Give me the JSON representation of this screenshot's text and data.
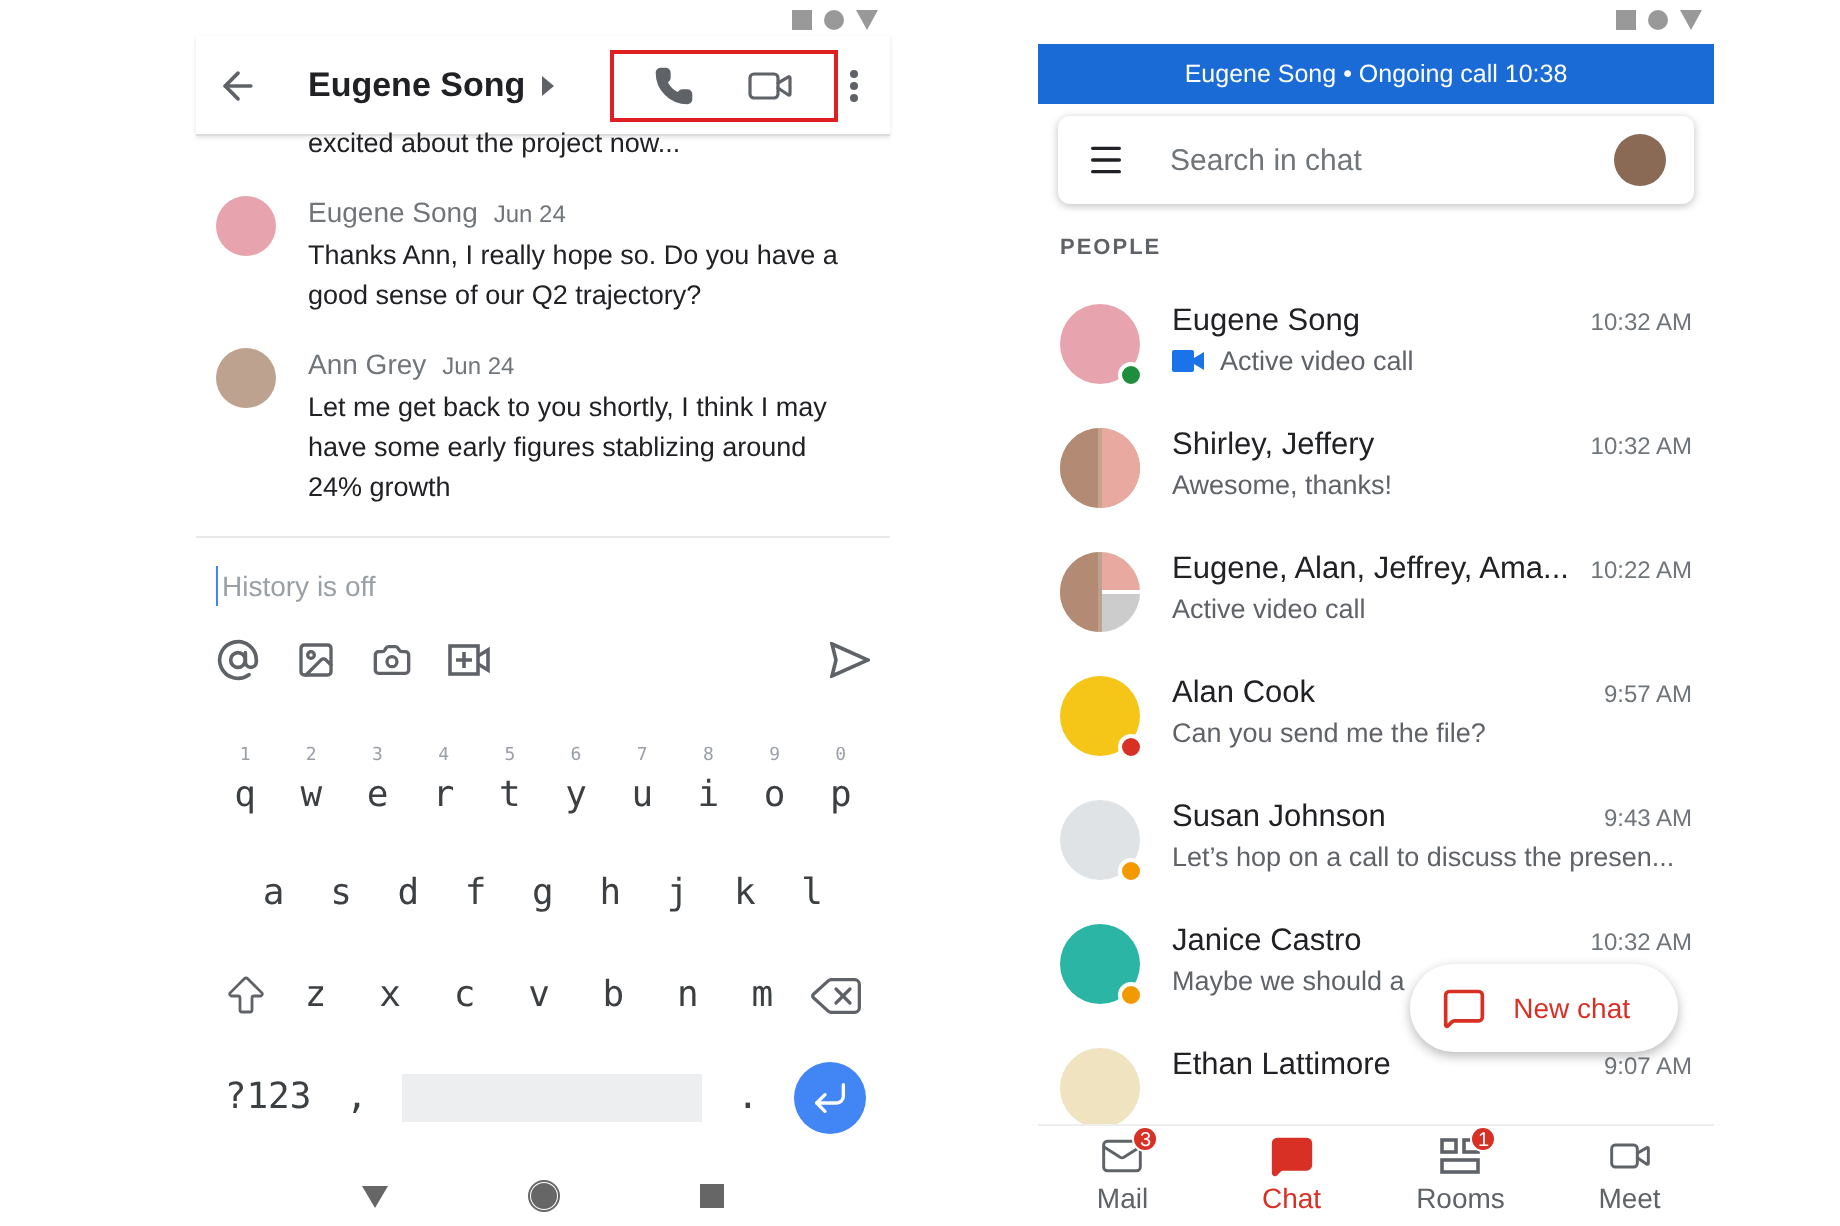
{
  "left_phone": {
    "header": {
      "title": "Eugene Song",
      "call_actions_highlighted": true
    },
    "messages": [
      {
        "kind": "continued",
        "text": "excited about the project now..."
      },
      {
        "kind": "full",
        "sender": "Eugene Song",
        "date": "Jun 24",
        "text": "Thanks Ann, I really hope so. Do you have a good sense of our Q2 trajectory?"
      },
      {
        "kind": "full",
        "sender": "Ann Grey",
        "date": "Jun 24",
        "text": "Let me get back to you shortly, I think I may have some early figures stablizing around 24% growth"
      }
    ],
    "composer": {
      "placeholder": "History is off"
    },
    "keyboard": {
      "rows": [
        [
          {
            "kind": "char",
            "label": "q",
            "hint": "1"
          },
          {
            "kind": "char",
            "label": "w",
            "hint": "2"
          },
          {
            "kind": "char",
            "label": "e",
            "hint": "3"
          },
          {
            "kind": "char",
            "label": "r",
            "hint": "4"
          },
          {
            "kind": "char",
            "label": "t",
            "hint": "5"
          },
          {
            "kind": "char",
            "label": "y",
            "hint": "6"
          },
          {
            "kind": "char",
            "label": "u",
            "hint": "7"
          },
          {
            "kind": "char",
            "label": "i",
            "hint": "8"
          },
          {
            "kind": "char",
            "label": "o",
            "hint": "9"
          },
          {
            "kind": "char",
            "label": "p",
            "hint": "0"
          }
        ],
        [
          {
            "kind": "char",
            "label": "a"
          },
          {
            "kind": "char",
            "label": "s"
          },
          {
            "kind": "char",
            "label": "d"
          },
          {
            "kind": "char",
            "label": "f"
          },
          {
            "kind": "char",
            "label": "g"
          },
          {
            "kind": "char",
            "label": "h"
          },
          {
            "kind": "char",
            "label": "j"
          },
          {
            "kind": "char",
            "label": "k"
          },
          {
            "kind": "char",
            "label": "l"
          }
        ],
        [
          {
            "kind": "shift"
          },
          {
            "kind": "char",
            "label": "z"
          },
          {
            "kind": "char",
            "label": "x"
          },
          {
            "kind": "char",
            "label": "c"
          },
          {
            "kind": "char",
            "label": "v"
          },
          {
            "kind": "char",
            "label": "b"
          },
          {
            "kind": "char",
            "label": "n"
          },
          {
            "kind": "char",
            "label": "m"
          },
          {
            "kind": "backspace"
          }
        ],
        [
          {
            "kind": "char",
            "label": "?123"
          },
          {
            "kind": "char",
            "label": ","
          },
          {
            "kind": "space"
          },
          {
            "kind": "char",
            "label": "."
          },
          {
            "kind": "enter"
          }
        ]
      ]
    }
  },
  "right_phone": {
    "call_banner": "Eugene Song • Ongoing call 10:38",
    "search": {
      "placeholder": "Search in chat"
    },
    "section_label": "PEOPLE",
    "conversations": [
      {
        "kind": "single",
        "name": "Eugene Song",
        "time": "10:32 AM",
        "preview": "Active video call",
        "video_call": true,
        "color": "#1e8e3e"
      },
      {
        "kind": "pair",
        "name": "Shirley, Jeffery",
        "time": "10:32 AM",
        "preview": "Awesome, thanks!",
        "video_call": false
      },
      {
        "kind": "group",
        "name": "Eugene, Alan, Jeffrey, Ama...",
        "time": "10:22 AM",
        "preview": "Active video call",
        "video_call": false
      },
      {
        "kind": "single",
        "name": "Alan Cook",
        "time": "9:57 AM",
        "preview": "Can you send me the file?",
        "video_call": false,
        "color": "#d93025"
      },
      {
        "kind": "single",
        "name": "Susan Johnson",
        "time": "9:43 AM",
        "preview": "Let’s hop on a call to discuss the presen...",
        "video_call": false,
        "color": "#f29900"
      },
      {
        "kind": "single",
        "name": "Janice Castro",
        "time": "10:32 AM",
        "preview": "Maybe we should a",
        "video_call": false,
        "color": "#f29900"
      },
      {
        "kind": "single",
        "name": "Ethan Lattimore",
        "time": "9:07 AM"
      }
    ],
    "fab": "New chat",
    "nav": [
      {
        "label": "Mail",
        "badge": "3",
        "selected": false,
        "kind": "mail"
      },
      {
        "label": "Chat",
        "selected": true,
        "kind": "chat"
      },
      {
        "label": "Rooms",
        "badge": "1",
        "selected": false,
        "kind": "rooms"
      },
      {
        "label": "Meet",
        "selected": false,
        "kind": "meet"
      }
    ]
  }
}
